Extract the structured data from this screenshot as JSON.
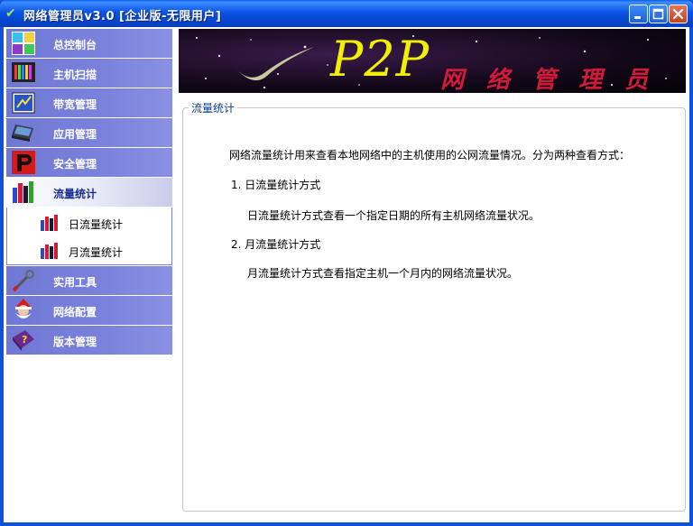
{
  "window": {
    "title": "网络管理员v3.0  [企业版-无限用户]",
    "controls": {
      "minimize": "minimize",
      "maximize": "maximize",
      "close": "close"
    }
  },
  "sidebar": {
    "items": [
      {
        "label": "总控制台",
        "icon": "control-panel-icon"
      },
      {
        "label": "主机扫描",
        "icon": "host-scan-icon"
      },
      {
        "label": "带宽管理",
        "icon": "bandwidth-icon"
      },
      {
        "label": "应用管理",
        "icon": "laptop-icon"
      },
      {
        "label": "安全管理",
        "icon": "security-p-icon"
      },
      {
        "label": "流量统计",
        "icon": "traffic-stats-icon",
        "active": true
      },
      {
        "label": "实用工具",
        "icon": "tools-icon"
      },
      {
        "label": "网络配置",
        "icon": "santa-icon"
      },
      {
        "label": "版本管理",
        "icon": "help-book-icon"
      }
    ],
    "subitems": [
      {
        "label": "日流量统计",
        "icon": "traffic-stats-icon"
      },
      {
        "label": "月流量统计",
        "icon": "traffic-stats-icon"
      }
    ]
  },
  "banner": {
    "big_text": "P2P",
    "cn_text": "网 络 管 理 员"
  },
  "main": {
    "group_title": "流量统计",
    "intro": "网络流量统计用来查看本地网络中的主机使用的公网流量情况。分为两种查看方式：",
    "section1_title": "1.  日流量统计方式",
    "section1_desc": "日流量统计方式查看一个指定日期的所有主机网络流量状况。",
    "section2_title": "2.  月流量统计方式",
    "section2_desc": "月流量统计方式查看指定主机一个月内的网络流量状况。"
  },
  "colors": {
    "titlebar": "#0a54e6",
    "nav_bg": "#7a82dc",
    "banner_yellow": "#f2f000",
    "banner_red": "#d41a3a"
  }
}
